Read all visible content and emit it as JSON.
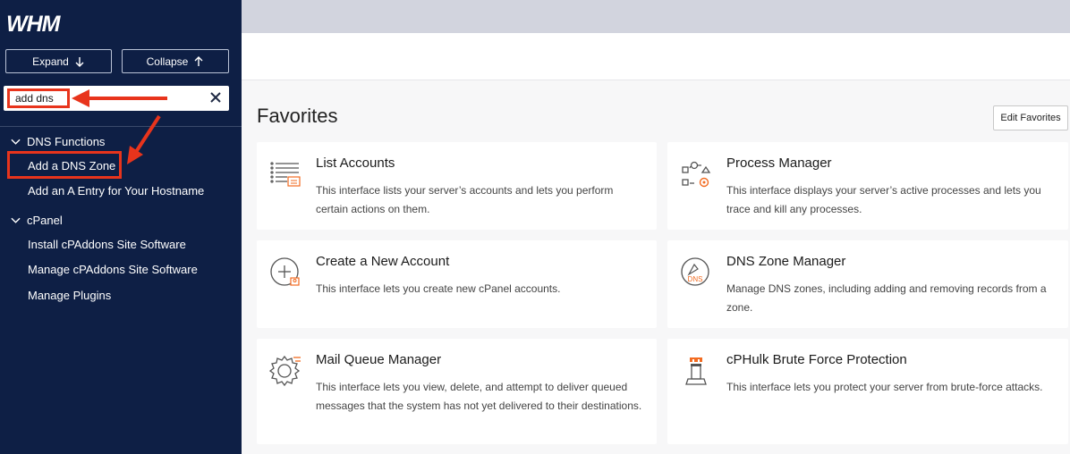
{
  "sidebar": {
    "logo_text": "WHM",
    "expand_label": "Expand",
    "collapse_label": "Collapse",
    "search_value": "add dns",
    "sections": [
      {
        "label": "DNS Functions",
        "items": [
          "Add a DNS Zone",
          "Add an A Entry for Your Hostname"
        ]
      },
      {
        "label": "cPanel",
        "items": [
          "Install cPAddons Site Software",
          "Manage cPAddons Site Software",
          "Manage Plugins"
        ]
      }
    ]
  },
  "main": {
    "title": "Favorites",
    "edit_button": "Edit Favorites",
    "cards": [
      {
        "title": "List Accounts",
        "desc": "This interface lists your server’s accounts and lets you perform certain actions on them.",
        "icon": "list-accounts-icon"
      },
      {
        "title": "Process Manager",
        "desc": "This interface displays your server’s active processes and lets you trace and kill any processes.",
        "icon": "process-manager-icon"
      },
      {
        "title": "Create a New Account",
        "desc": "This interface lets you create new cPanel accounts.",
        "icon": "create-account-icon"
      },
      {
        "title": "DNS Zone Manager",
        "desc": "Manage DNS zones, including adding and removing records from a zone.",
        "icon": "dns-zone-icon",
        "icon_text": "DNS"
      },
      {
        "title": "Mail Queue Manager",
        "desc": "This interface lets you view, delete, and attempt to deliver queued messages that the system has not yet delivered to their destinations.",
        "icon": "mail-queue-icon"
      },
      {
        "title": "cPHulk Brute Force Protection",
        "desc": "This interface lets you protect your server from brute-force attacks.",
        "icon": "cphulk-icon"
      }
    ]
  },
  "colors": {
    "sidebar_bg": "#0e1f45",
    "accent_orange": "#f26b21",
    "annotation_red": "#e8341c"
  }
}
